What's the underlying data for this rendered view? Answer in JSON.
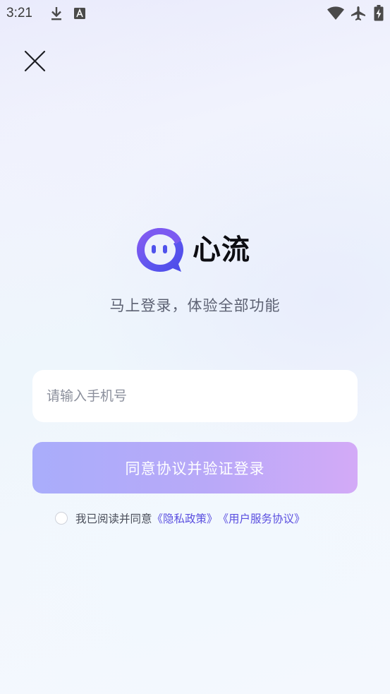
{
  "status_bar": {
    "time": "3:21"
  },
  "brand": {
    "name": "心流"
  },
  "subtitle": "马上登录，体验全部功能",
  "phone_input": {
    "placeholder": "请输入手机号",
    "value": ""
  },
  "login_button": {
    "label": "同意协议并验证登录"
  },
  "agreement": {
    "prefix": "我已阅读并同意",
    "privacy_link": "《隐私政策》",
    "service_link": "《用户服务协议》"
  },
  "colors": {
    "accent": "#5a4fe0",
    "button_gradient_start": "#a9adfb",
    "button_gradient_end": "#d3aaf7",
    "logo_gradient_start": "#7b5cf0",
    "logo_gradient_end": "#4a4ae8"
  },
  "icons": {
    "close": "close-icon",
    "download": "download-icon",
    "notification": "font-notification-icon",
    "wifi": "wifi-icon",
    "airplane": "airplane-mode-icon",
    "battery": "battery-charging-icon",
    "logo": "brand-logo-icon"
  }
}
